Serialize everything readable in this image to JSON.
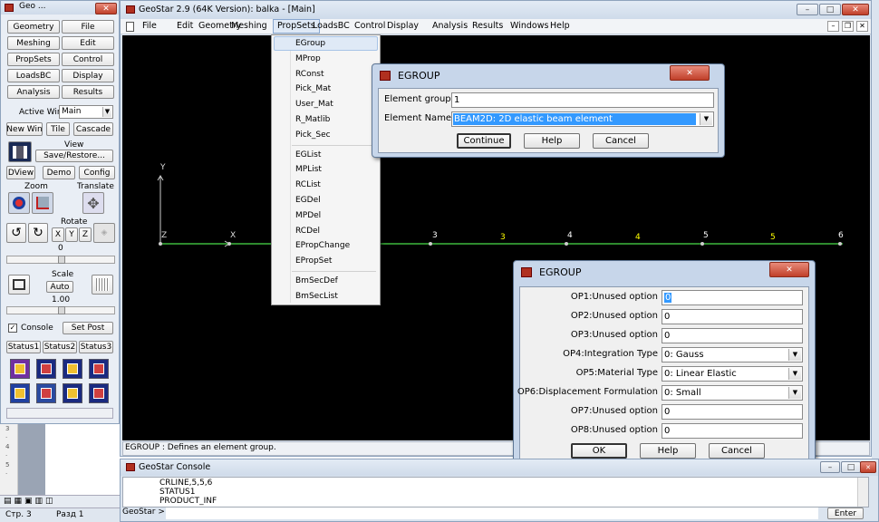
{
  "left_panel": {
    "title": "Geo ...",
    "rows": [
      [
        "Geometry",
        "File"
      ],
      [
        "Meshing",
        "Edit"
      ],
      [
        "PropSets",
        "Control"
      ],
      [
        "LoadsBC",
        "Display"
      ],
      [
        "Analysis",
        "Results"
      ]
    ],
    "active_win_label": "Active Win",
    "active_win_value": "Main",
    "row2": [
      "New Win",
      "Tile",
      "Cascade"
    ],
    "view_label": "View",
    "save_restore": "Save/Restore...",
    "row3": [
      "DView",
      "Demo",
      "Config"
    ],
    "zoom_label": "Zoom",
    "translate_label": "Translate",
    "rotate_label": "Rotate",
    "rotate_axes": [
      "X",
      "Y",
      "Z"
    ],
    "rotate_value": "0",
    "scale_label": "Scale",
    "scale_auto": "Auto",
    "scale_value": "1.00",
    "console_label": "Console",
    "set_post": "Set Post",
    "status_tabs": [
      "Status1",
      "Status2",
      "Status3"
    ]
  },
  "main_window": {
    "title": "GeoStar 2.9 (64K Version): balka - [Main]",
    "menu": [
      "File",
      "Edit",
      "Geometry",
      "Meshing",
      "PropSets",
      "LoadsBC",
      "Control",
      "Display",
      "Analysis",
      "Results",
      "Windows",
      "Help"
    ],
    "status_text": "EGROUP : Defines an element group."
  },
  "propsets_menu": {
    "group1": [
      "EGroup",
      "MProp",
      "RConst",
      "Pick_Mat",
      "User_Mat",
      "R_Matlib",
      "Pick_Sec"
    ],
    "group2": [
      "EGList",
      "MPList",
      "RCList",
      "EGDel",
      "MPDel",
      "RCDel",
      "EPropChange",
      "EPropSet"
    ],
    "group3": [
      "BmSecDef",
      "BmSecList"
    ]
  },
  "canvas": {
    "axis_y": "Y",
    "axis_x": "X",
    "axis_z": "Z",
    "node_labels": [
      "3",
      "4",
      "5",
      "6"
    ],
    "element_labels": [
      "3",
      "4",
      "5"
    ],
    "colors": {
      "background": "#000000",
      "line": "#2e8b2e",
      "node_label": "#ffffff",
      "element_label": "#ffff00"
    }
  },
  "egroup_dialog1": {
    "title": "EGROUP",
    "element_group_label": "Element group",
    "element_group_value": "1",
    "element_name_label": "Element Name",
    "element_name_value": "BEAM2D:    2D elastic beam element",
    "buttons": [
      "Continue",
      "Help",
      "Cancel"
    ]
  },
  "egroup_dialog2": {
    "title": "EGROUP",
    "options": [
      {
        "label": "OP1:Unused option",
        "value": "0",
        "type": "text"
      },
      {
        "label": "OP2:Unused option",
        "value": "0",
        "type": "text"
      },
      {
        "label": "OP3:Unused option",
        "value": "0",
        "type": "text"
      },
      {
        "label": "OP4:Integration Type",
        "value": "0: Gauss",
        "type": "combo"
      },
      {
        "label": "OP5:Material Type",
        "value": "0:   Linear Elastic",
        "type": "combo"
      },
      {
        "label": "OP6:Displacement Formulation",
        "value": "0: Small",
        "type": "combo"
      },
      {
        "label": "OP7:Unused option",
        "value": "0",
        "type": "text"
      },
      {
        "label": "OP8:Unused option",
        "value": "0",
        "type": "text"
      }
    ],
    "buttons": [
      "OK",
      "Help",
      "Cancel"
    ]
  },
  "console": {
    "title": "GeoStar Console",
    "lines": [
      "CRLINE,5,5,6",
      "STATUS1",
      "PRODUCT_INF"
    ],
    "prompt": "GeoStar >",
    "enter_button": "Enter"
  },
  "word_status": {
    "page": "Стр. 3",
    "section": "Разд 1"
  }
}
